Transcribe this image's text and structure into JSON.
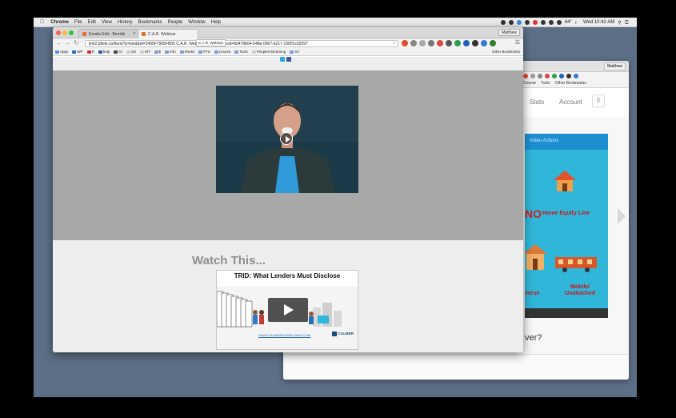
{
  "menubar": {
    "app": "Chrome",
    "items": [
      "File",
      "Edit",
      "View",
      "History",
      "Bookmarks",
      "People",
      "Window",
      "Help"
    ],
    "weather": "44°",
    "clock": "Wed 10:42 AM"
  },
  "browser": {
    "profile": "Matthew",
    "tabs": [
      {
        "label": "Emails Edit - Bombb",
        "active": false
      },
      {
        "label": "C.A.R. Webinar",
        "active": true
      }
    ],
    "tooltip": "C.A.R. Webinar",
    "url": "link2.bbink.co/tbext?p=land&id=2405F7905FB05 C.A.R. Webinar D07F3315&vid=8d479b64-648e-0967-b217-15f2f1c92097",
    "bookmarks": [
      "Apps",
      "WP",
      "R",
      "help",
      "Oi",
      "SD",
      "MT",
      "$",
      "Info",
      "Works",
      "FFS",
      "Course",
      "Tools",
      "Peoples Elearning",
      "SV"
    ],
    "other_bookmarks": "Other Bookmarks"
  },
  "page": {
    "section_heading": "Watch This...",
    "featured_video": {
      "title": "TRID: What Lenders Must Disclose",
      "url": "WWW.CALIBERHOMELOANS.COM",
      "brand": "CALIBER"
    }
  },
  "back_window": {
    "profile": "Matthew",
    "bookmarks": [
      "Course",
      "Tools",
      "Other Bookmarks"
    ],
    "nav": {
      "stats": "Stats",
      "account": "Account"
    },
    "video_actions": "Video Actions",
    "slide": {
      "no": "NO",
      "home_equity": "Home Equity Line",
      "reverse": "verse",
      "mobile": "Mobile/",
      "unattached": "Unattached"
    },
    "question": "ver?"
  },
  "colors": {
    "hero_bg": "#a8a8a8",
    "page_bg": "#ededed",
    "slide_bg": "#2fb6d9",
    "accent_red": "#c91818"
  }
}
